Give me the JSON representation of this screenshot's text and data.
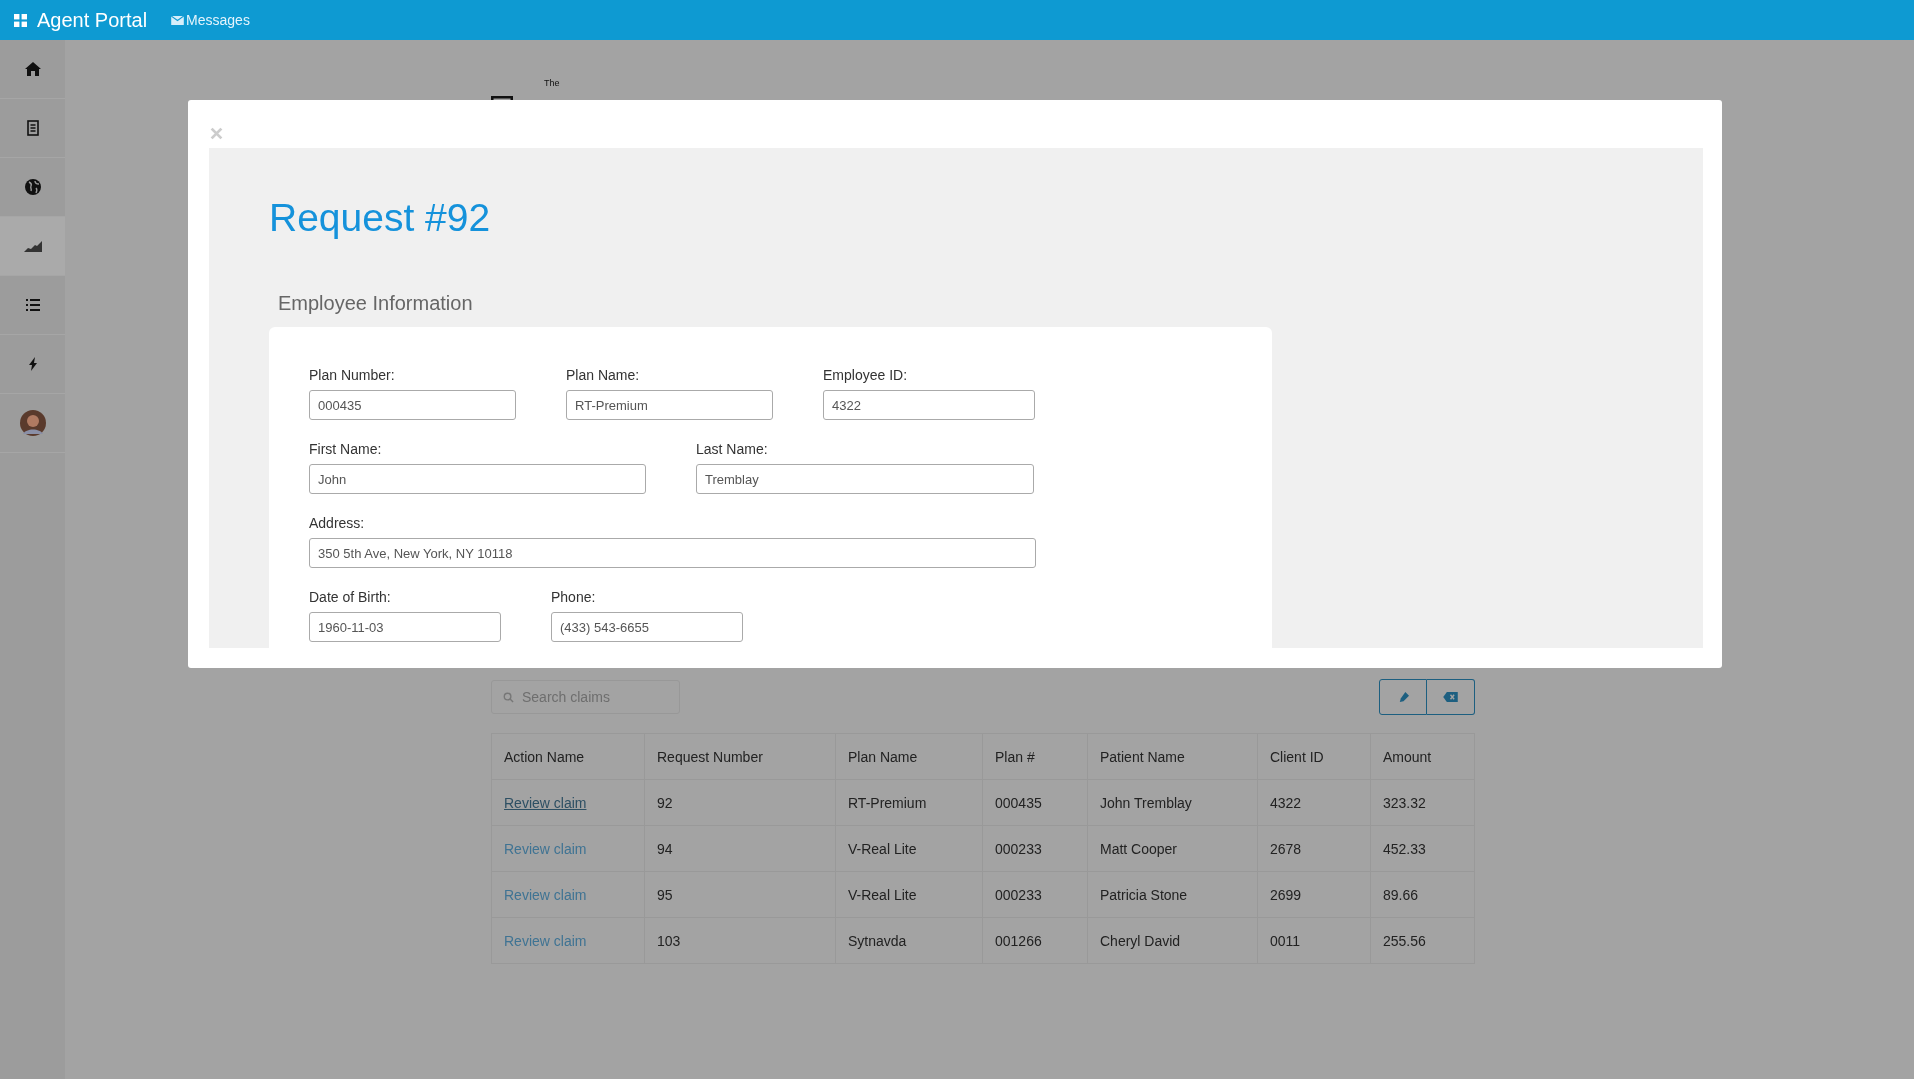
{
  "topbar": {
    "app_name": "Agent Portal",
    "messages_link": "Messages"
  },
  "sidebar": {
    "items": [
      {
        "kind": "home",
        "selected": false
      },
      {
        "kind": "document",
        "selected": false
      },
      {
        "kind": "globe",
        "selected": false
      },
      {
        "kind": "chart",
        "selected": true
      },
      {
        "kind": "list",
        "selected": false
      },
      {
        "kind": "bolt",
        "selected": false
      },
      {
        "kind": "avatar",
        "selected": false
      }
    ]
  },
  "logo": {
    "small": "The"
  },
  "claims": {
    "search": {
      "placeholder": "Search claims"
    },
    "columns": [
      "Action Name",
      "Request Number",
      "Plan Name",
      "Plan #",
      "Patient Name",
      "Client ID",
      "Amount"
    ],
    "rows": [
      {
        "hovered": true,
        "cells": [
          "Review claim",
          "92",
          "RT-Premium",
          "000435",
          "John Tremblay",
          "4322",
          "323.32"
        ]
      },
      {
        "hovered": false,
        "cells": [
          "Review claim",
          "94",
          "V-Real Lite",
          "000233",
          "Matt Cooper",
          "2678",
          "452.33"
        ]
      },
      {
        "hovered": false,
        "cells": [
          "Review claim",
          "95",
          "V-Real Lite",
          "000233",
          "Patricia Stone",
          "2699",
          "89.66"
        ]
      },
      {
        "hovered": false,
        "cells": [
          "Review claim",
          "103",
          "Sytnavda",
          "001266",
          "Cheryl David",
          "0011",
          "255.56"
        ]
      }
    ]
  },
  "modal": {
    "title": "Request #92",
    "section": "Employee Information",
    "rows": [
      [
        {
          "label": "Plan Number:",
          "value": "000435"
        },
        {
          "label": "Plan Name:",
          "value": "RT-Premium"
        },
        {
          "label": "Employee ID:",
          "value": "4322"
        }
      ],
      [
        {
          "label": "First Name:",
          "value": "John"
        },
        {
          "label": "Last Name:",
          "value": "Tremblay"
        }
      ],
      [
        {
          "label": "Address:",
          "value": "350 5th Ave, New York, NY 10118"
        }
      ],
      [
        {
          "label": "Date of Birth:",
          "value": "1960-11-03"
        },
        {
          "label": "Phone:",
          "value": "(433) 543-6655"
        }
      ]
    ]
  }
}
